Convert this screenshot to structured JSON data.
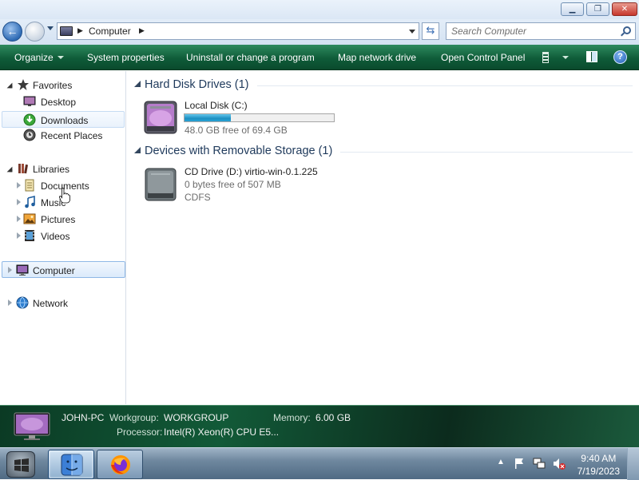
{
  "window": {
    "controls": [
      "minimize",
      "maximize",
      "close"
    ]
  },
  "address_bar": {
    "path_text": "Computer",
    "search_placeholder": "Search Computer"
  },
  "command_bar": {
    "organize": "Organize",
    "system_properties": "System properties",
    "uninstall": "Uninstall or change a program",
    "map_network": "Map network drive",
    "control_panel": "Open Control Panel"
  },
  "nav_pane": {
    "favorites": "Favorites",
    "desktop": "Desktop",
    "downloads": "Downloads",
    "recent_places": "Recent Places",
    "libraries": "Libraries",
    "documents": "Documents",
    "music": "Music",
    "pictures": "Pictures",
    "videos": "Videos",
    "computer": "Computer",
    "network": "Network"
  },
  "content": {
    "hard_disk_header": "Hard Disk Drives (1)",
    "local_disk": {
      "name": "Local Disk (C:)",
      "free_text": "48.0 GB free of 69.4 GB",
      "used_fraction": 0.31
    },
    "removable_header": "Devices with Removable Storage (1)",
    "cd_drive": {
      "name": "CD Drive (D:) virtio-win-0.1.225",
      "free_text": "0 bytes free of 507 MB",
      "filesystem": "CDFS"
    }
  },
  "details": {
    "computer_name": "JOHN-PC",
    "workgroup_label": "Workgroup:",
    "workgroup": "WORKGROUP",
    "memory_label": "Memory:",
    "memory": "6.00 GB",
    "processor_label": "Processor:",
    "processor": "Intel(R) Xeon(R) CPU E5..."
  },
  "taskbar": {
    "time": "9:40 AM",
    "date": "7/19/2023"
  },
  "colors": {
    "command_bar": "#0f5c39",
    "accent_blue": "#1e395b",
    "usage_fill": "#1d8fc1"
  }
}
